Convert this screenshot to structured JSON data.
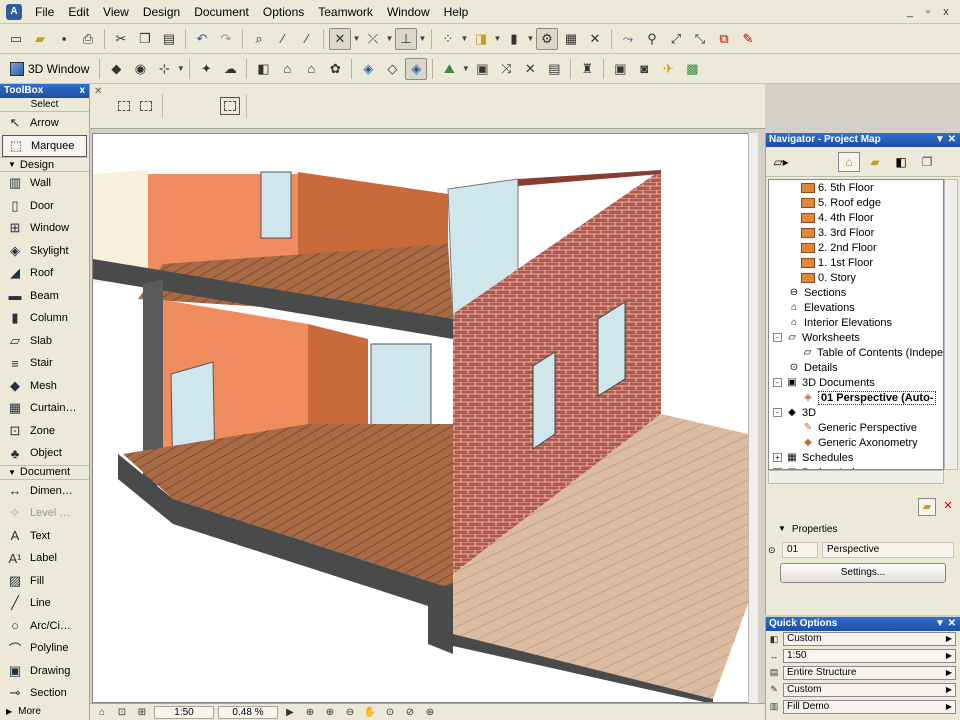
{
  "menubar": {
    "app_icon_name": "archicad-icon",
    "items": [
      "File",
      "Edit",
      "View",
      "Design",
      "Document",
      "Options",
      "Teamwork",
      "Window",
      "Help"
    ],
    "window_controls": [
      "_",
      "▫",
      "x"
    ]
  },
  "toolbar2": {
    "window_label": "3D Window"
  },
  "toolbox": {
    "title": "ToolBox",
    "close": "x",
    "select_label": "Select",
    "select_items": [
      {
        "label": "Arrow",
        "icon": "arrow-icon",
        "glyph": "↖",
        "selected": false
      },
      {
        "label": "Marquee",
        "icon": "marquee-icon",
        "glyph": "⬚",
        "selected": true
      }
    ],
    "design_group": "Design",
    "design_items": [
      {
        "label": "Wall",
        "icon": "wall-icon",
        "glyph": "▥"
      },
      {
        "label": "Door",
        "icon": "door-icon",
        "glyph": "▯"
      },
      {
        "label": "Window",
        "icon": "window-icon",
        "glyph": "⊞"
      },
      {
        "label": "Skylight",
        "icon": "skylight-icon",
        "glyph": "◈"
      },
      {
        "label": "Roof",
        "icon": "roof-icon",
        "glyph": "◢"
      },
      {
        "label": "Beam",
        "icon": "beam-icon",
        "glyph": "▬"
      },
      {
        "label": "Column",
        "icon": "column-icon",
        "glyph": "▮"
      },
      {
        "label": "Slab",
        "icon": "slab-icon",
        "glyph": "▱"
      },
      {
        "label": "Stair",
        "icon": "stair-icon",
        "glyph": "≡"
      },
      {
        "label": "Mesh",
        "icon": "mesh-icon",
        "glyph": "◆"
      },
      {
        "label": "Curtain…",
        "icon": "curtain-wall-icon",
        "glyph": "▦"
      },
      {
        "label": "Zone",
        "icon": "zone-icon",
        "glyph": "⊡"
      },
      {
        "label": "Object",
        "icon": "object-icon",
        "glyph": "♣"
      }
    ],
    "document_group": "Document",
    "document_items": [
      {
        "label": "Dimen…",
        "icon": "dimension-icon",
        "glyph": "↔",
        "disabled": false
      },
      {
        "label": "Level …",
        "icon": "level-dimension-icon",
        "glyph": "✧",
        "disabled": true
      },
      {
        "label": "Text",
        "icon": "text-icon",
        "glyph": "A",
        "disabled": false
      },
      {
        "label": "Label",
        "icon": "label-icon",
        "glyph": "A¹",
        "disabled": false
      },
      {
        "label": "Fill",
        "icon": "fill-icon",
        "glyph": "▨",
        "disabled": false
      },
      {
        "label": "Line",
        "icon": "line-icon",
        "glyph": "╱",
        "disabled": false
      },
      {
        "label": "Arc/Ci…",
        "icon": "arc-circle-icon",
        "glyph": "○",
        "disabled": false
      },
      {
        "label": "Polyline",
        "icon": "polyline-icon",
        "glyph": "⌒",
        "disabled": false
      },
      {
        "label": "Drawing",
        "icon": "drawing-icon",
        "glyph": "▣",
        "disabled": false
      },
      {
        "label": "Section",
        "icon": "section-icon",
        "glyph": "⊸",
        "disabled": false
      }
    ],
    "more_label": "More"
  },
  "statusbar": {
    "scale": "1:50",
    "zoom": "0.48 %"
  },
  "navigator": {
    "title": "Navigator - Project Map",
    "tree": [
      {
        "label": "6. 5th Floor",
        "indent": 2,
        "icon": "story",
        "toggle": ""
      },
      {
        "label": "5. Roof edge",
        "indent": 2,
        "icon": "story",
        "toggle": ""
      },
      {
        "label": "4. 4th Floor",
        "indent": 2,
        "icon": "story",
        "toggle": ""
      },
      {
        "label": "3. 3rd Floor",
        "indent": 2,
        "icon": "story",
        "toggle": ""
      },
      {
        "label": "2. 2nd Floor",
        "indent": 2,
        "icon": "story",
        "toggle": ""
      },
      {
        "label": "1. 1st Floor",
        "indent": 2,
        "icon": "story",
        "toggle": ""
      },
      {
        "label": "0. Story",
        "indent": 2,
        "icon": "story",
        "toggle": ""
      },
      {
        "label": "Sections",
        "indent": 1,
        "icon": "section",
        "toggle": ""
      },
      {
        "label": "Elevations",
        "indent": 1,
        "icon": "elevation",
        "toggle": ""
      },
      {
        "label": "Interior Elevations",
        "indent": 1,
        "icon": "elevation",
        "toggle": ""
      },
      {
        "label": "Worksheets",
        "indent": 1,
        "icon": "worksheet",
        "toggle": "-"
      },
      {
        "label": "Table of Contents (Indepe",
        "indent": 2,
        "icon": "worksheet",
        "toggle": ""
      },
      {
        "label": "Details",
        "indent": 1,
        "icon": "detail",
        "toggle": ""
      },
      {
        "label": "3D Documents",
        "indent": 1,
        "icon": "doc3d",
        "toggle": "-"
      },
      {
        "label": "01 Perspective (Auto-",
        "indent": 2,
        "icon": "perspective",
        "toggle": "",
        "selected": true
      },
      {
        "label": "3D",
        "indent": 1,
        "icon": "cube",
        "toggle": "-"
      },
      {
        "label": "Generic Perspective",
        "indent": 2,
        "icon": "camera",
        "toggle": ""
      },
      {
        "label": "Generic Axonometry",
        "indent": 2,
        "icon": "axon",
        "toggle": ""
      },
      {
        "label": "Schedules",
        "indent": 1,
        "icon": "schedule",
        "toggle": "+"
      },
      {
        "label": "Project Indexes",
        "indent": 1,
        "icon": "schedule",
        "toggle": "+"
      }
    ],
    "properties_label": "Properties",
    "prop_id": "01",
    "prop_name": "Perspective",
    "settings_label": "Settings..."
  },
  "quick_options": {
    "title": "Quick Options",
    "rows": [
      {
        "icon": "layer-combination-icon",
        "glyph": "◧",
        "value": "Custom"
      },
      {
        "icon": "scale-icon",
        "glyph": "↔",
        "value": "1:50"
      },
      {
        "icon": "structure-display-icon",
        "glyph": "▤",
        "value": "Entire Structure"
      },
      {
        "icon": "pen-set-icon",
        "glyph": "✎",
        "value": "Custom"
      },
      {
        "icon": "model-view-icon",
        "glyph": "▥",
        "value": "Fill Demo"
      }
    ]
  }
}
